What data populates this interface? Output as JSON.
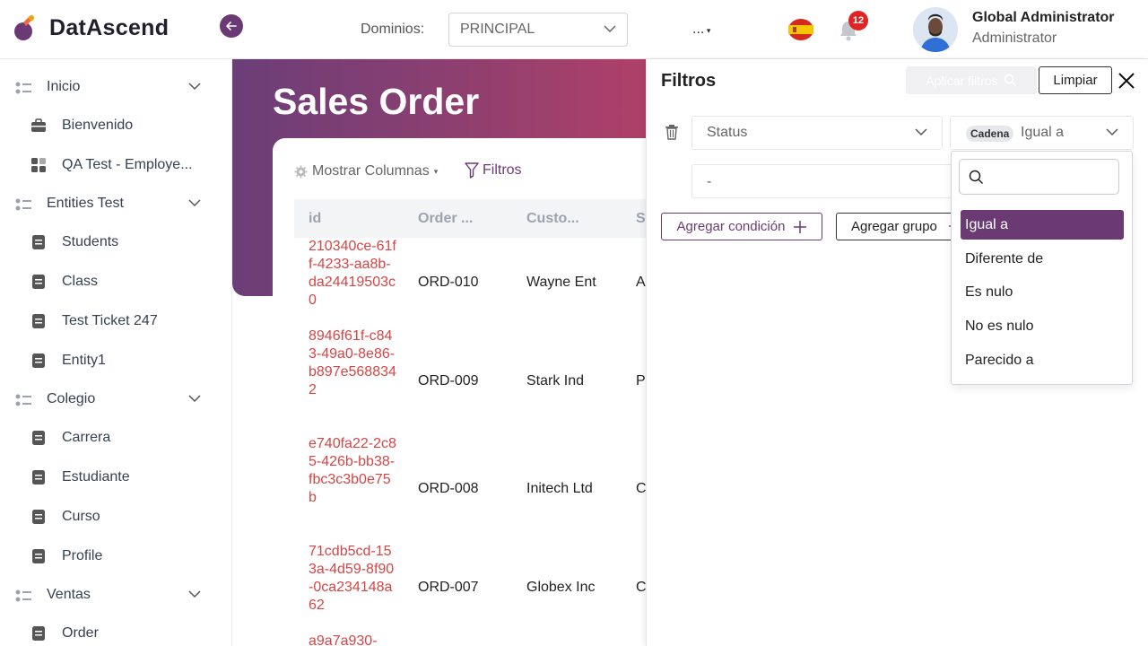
{
  "header": {
    "brand": "DatAscend",
    "domain_label": "Dominios:",
    "domain_value": "PRINCIPAL",
    "more_label": "...",
    "notification_count": "12",
    "user_name": "Global Administrator",
    "user_role": "Administrator"
  },
  "sidebar": {
    "groups": [
      {
        "label": "Inicio",
        "items": [
          "Bienvenido",
          "QA Test - Employe..."
        ]
      },
      {
        "label": "Entities Test",
        "items": [
          "Students",
          "Class",
          "Test Ticket 247",
          "Entity1"
        ]
      },
      {
        "label": "Colegio",
        "items": [
          "Carrera",
          "Estudiante",
          "Curso",
          "Profile"
        ]
      },
      {
        "label": "Ventas",
        "items": [
          "Order"
        ]
      }
    ]
  },
  "main": {
    "title": "Sales Order",
    "show_columns": "Mostrar Columnas",
    "filters_link": "Filtros",
    "columns": [
      "id",
      "Order ...",
      "Custo...",
      "St"
    ],
    "rows": [
      {
        "id": "210340ce-61ff-4233-aa8b-da24419503c0",
        "order": "ORD-010",
        "customer": "Wayne Ent",
        "status": "A"
      },
      {
        "id": "8946f61f-c843-49a0-8e86-b897e5688342",
        "order": "ORD-009",
        "customer": "Stark Ind",
        "status": "Pe"
      },
      {
        "id": "e740fa22-2c85-426b-bb38-fbc3c3b0e75b",
        "order": "ORD-008",
        "customer": "Initech Ltd",
        "status": "C"
      },
      {
        "id": "71cdb5cd-153a-4d59-8f90-0ca234148a62",
        "order": "ORD-007",
        "customer": "Globex Inc",
        "status": "C"
      },
      {
        "id": "a9a7a930-",
        "order": "",
        "customer": "",
        "status": ""
      }
    ]
  },
  "filter_panel": {
    "title": "Filtros",
    "apply_label": "Aplicar filtros",
    "clear_label": "Limpiar",
    "field_value": "Status",
    "type_tag": "Cadena",
    "operator_value": "Igual a",
    "value_input": "-",
    "add_condition_label": "Agregar condición",
    "add_group_label": "Agregar grupo",
    "operator_options": [
      "Igual a",
      "Diferente de",
      "Es nulo",
      "No es nulo",
      "Parecido a"
    ],
    "search_placeholder": ""
  },
  "colors": {
    "accent": "#6b3a75",
    "id_link": "#d64545",
    "badge": "#e02424"
  }
}
